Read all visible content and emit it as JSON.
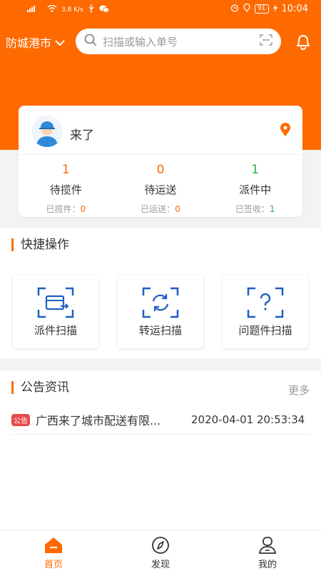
{
  "status_bar": {
    "signal": "4G",
    "speed": "3.8 K/s",
    "battery": "91",
    "time": "10:04"
  },
  "header": {
    "city": "防城港市",
    "search_placeholder": "扫描或输入单号"
  },
  "user_card": {
    "name": "来了",
    "stats": [
      {
        "count": "1",
        "label": "待揽件",
        "sub_label": "已揽件：",
        "sub_value": "0",
        "count_color": "#ff6a00",
        "sub_color": "#ff6a00"
      },
      {
        "count": "0",
        "label": "待运送",
        "sub_label": "已运送：",
        "sub_value": "0",
        "count_color": "#ff6a00",
        "sub_color": "#ff6a00"
      },
      {
        "count": "1",
        "label": "派件中",
        "sub_label": "已签收：",
        "sub_value": "1",
        "count_color": "#2bb24c",
        "sub_color": "#2bb24c"
      }
    ]
  },
  "quick_actions": {
    "title": "快捷操作",
    "items": [
      {
        "label": "派件扫描",
        "icon": "delivery-scan-icon"
      },
      {
        "label": "转运扫描",
        "icon": "transfer-scan-icon"
      },
      {
        "label": "问题件扫描",
        "icon": "problem-scan-icon"
      }
    ]
  },
  "notices": {
    "title": "公告资讯",
    "more": "更多",
    "items": [
      {
        "badge": "公告",
        "title": "广西来了城市配送有限...",
        "time": "2020-04-01 20:53:34"
      }
    ]
  },
  "tabbar": {
    "items": [
      {
        "label": "首页",
        "icon": "home-icon",
        "active": true
      },
      {
        "label": "发现",
        "icon": "compass-icon",
        "active": false
      },
      {
        "label": "我的",
        "icon": "user-icon",
        "active": false
      }
    ]
  },
  "colors": {
    "brand": "#ff6a00",
    "accent_blue": "#1f5fbf",
    "success": "#2bb24c"
  }
}
